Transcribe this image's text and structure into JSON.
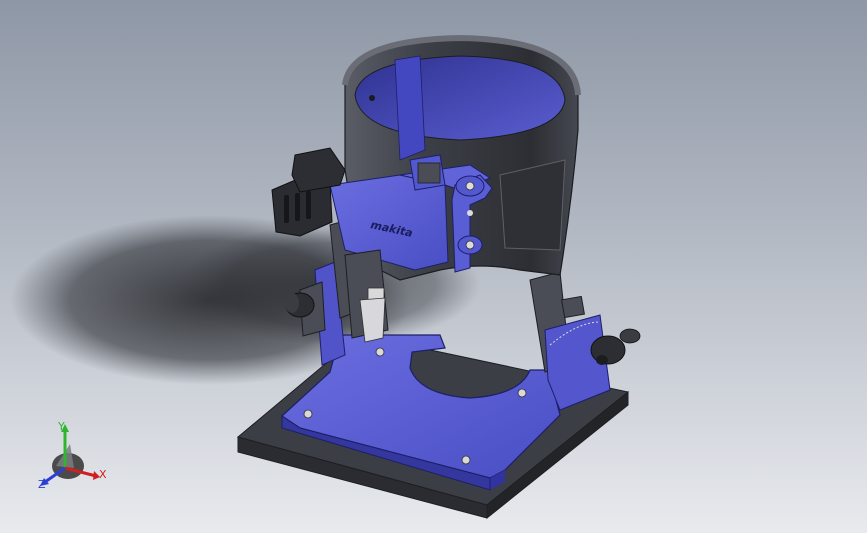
{
  "viewport": {
    "background_top": "#8e97a6",
    "background_bottom": "#e8eaee"
  },
  "model": {
    "brand_logo": "makita",
    "colors": {
      "blue_part": "#5b5fd6",
      "blue_dark": "#3a3d9e",
      "gray_part": "#4a4d55",
      "gray_dark": "#2e3036",
      "gray_light": "#6c707a",
      "base_plate": "#3f4248"
    }
  },
  "triad": {
    "x_label": "X",
    "y_label": "Y",
    "z_label": "Z",
    "x_color": "#d11f1f",
    "y_color": "#2fb52f",
    "z_color": "#2b3fd6"
  }
}
